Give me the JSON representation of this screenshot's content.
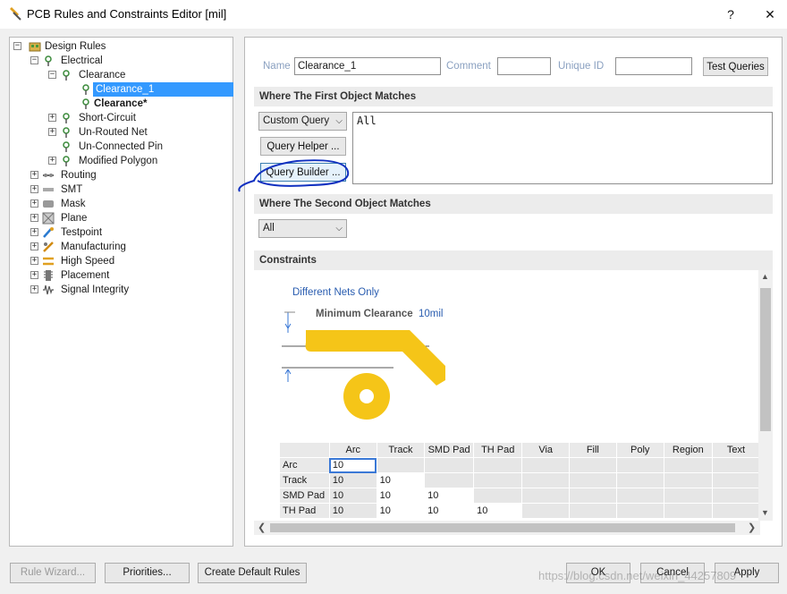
{
  "window": {
    "title": "PCB Rules and Constraints Editor [mil]",
    "help_label": "?",
    "close_label": "✕"
  },
  "tree": {
    "root": "Design Rules",
    "electrical": "Electrical",
    "clearance": "Clearance",
    "clearance_1": "Clearance_1",
    "clearance_star": "Clearance*",
    "short_circuit": "Short-Circuit",
    "unrouted": "Un-Routed Net",
    "unconnected": "Un-Connected Pin",
    "modified_poly": "Modified Polygon",
    "routing": "Routing",
    "smt": "SMT",
    "mask": "Mask",
    "plane": "Plane",
    "testpoint": "Testpoint",
    "manufacturing": "Manufacturing",
    "high_speed": "High Speed",
    "placement": "Placement",
    "signal_integrity": "Signal Integrity"
  },
  "rule": {
    "name_label": "Name",
    "name_value": "Clearance_1",
    "comment_label": "Comment",
    "comment_value": "",
    "unique_label": "Unique ID",
    "unique_value": "",
    "test_queries": "Test Queries"
  },
  "first_match": {
    "heading": "Where The First Object Matches",
    "dropdown": "Custom Query",
    "query_helper": "Query Helper ...",
    "query_builder": "Query Builder ...",
    "query_text": "All"
  },
  "second_match": {
    "heading": "Where The Second Object Matches",
    "dropdown": "All"
  },
  "constraints": {
    "heading": "Constraints",
    "mode": "Different Nets Only",
    "min_label": "Minimum Clearance",
    "min_value": "10mil",
    "columns": [
      "Arc",
      "Track",
      "SMD Pad",
      "TH Pad",
      "Via",
      "Fill",
      "Poly",
      "Region",
      "Text"
    ],
    "rows": [
      {
        "name": "Arc",
        "values": [
          "10"
        ]
      },
      {
        "name": "Track",
        "values": [
          "10",
          "10"
        ]
      },
      {
        "name": "SMD Pad",
        "values": [
          "10",
          "10",
          "10"
        ]
      },
      {
        "name": "TH Pad",
        "values": [
          "10",
          "10",
          "10",
          "10"
        ]
      }
    ]
  },
  "footer": {
    "rule_wizard": "Rule Wizard...",
    "priorities": "Priorities...",
    "create_defaults": "Create Default Rules",
    "ok": "OK",
    "cancel": "Cancel",
    "apply": "Apply"
  },
  "watermark": "https://blog.csdn.net/weixin_44257809",
  "colors": {
    "selection": "#3399ff",
    "pcb_copper": "#f5c518",
    "annotation_ink": "#1030c0"
  }
}
